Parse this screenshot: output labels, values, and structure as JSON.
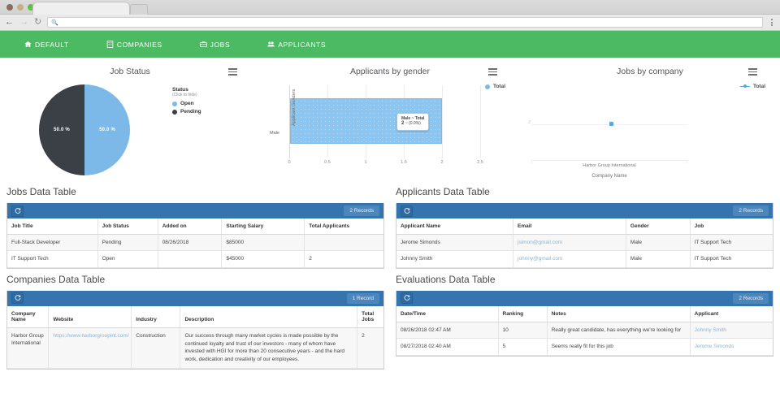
{
  "browser": {
    "url_value": "",
    "url_placeholder": "",
    "back_icon": "back-arrow-icon",
    "forward_icon": "forward-arrow-icon",
    "reload_icon": "reload-icon",
    "search_icon": "search-icon",
    "menu_icon": "kebab-menu-icon"
  },
  "appnav": {
    "items": [
      {
        "label": "DEFAULT",
        "icon": "home-icon"
      },
      {
        "label": "COMPANIES",
        "icon": "building-icon"
      },
      {
        "label": "JOBS",
        "icon": "briefcase-icon"
      },
      {
        "label": "APPLICANTS",
        "icon": "users-icon"
      }
    ],
    "bg_color": "#4cb963"
  },
  "chart_data": [
    {
      "type": "pie",
      "title": "Job Status",
      "categories": [
        "Open",
        "Pending"
      ],
      "values": [
        50.0,
        50.0
      ],
      "data_labels": [
        "50.0 %",
        "50.0 %"
      ],
      "colors": [
        "#7cb9e8",
        "#3b3f46"
      ],
      "legend": {
        "title": "Status",
        "subtitle": "(Click to hide)",
        "position": "right",
        "entries": [
          {
            "label": "Open",
            "color": "#7cb9e8"
          },
          {
            "label": "Pending",
            "color": "#3b3f46"
          }
        ]
      },
      "menu_icon": "hamburger-menu-icon"
    },
    {
      "type": "bar",
      "orientation": "horizontal",
      "title": "Applicants by gender",
      "categories": [
        "Male"
      ],
      "series": [
        {
          "name": "Total",
          "values": [
            2
          ]
        }
      ],
      "xlabel": "",
      "ylabel": "Applicant Genders",
      "xlim": [
        0,
        2.5
      ],
      "xticks": [
        "0",
        "0.5",
        "1",
        "1.5",
        "2",
        "2.5"
      ],
      "grid": true,
      "legend": {
        "position": "top-right",
        "entries": [
          {
            "label": "Total",
            "color": "#7cb9e8"
          }
        ]
      },
      "tooltip": {
        "header": "Male ~ Total",
        "value": "2",
        "percent": "~ (0.0%)"
      },
      "colors": [
        "#8cc6f0"
      ],
      "menu_icon": "hamburger-menu-icon"
    },
    {
      "type": "line",
      "title": "Jobs by company",
      "categories": [
        "Harbor Group International"
      ],
      "series": [
        {
          "name": "Total",
          "values": [
            2
          ]
        }
      ],
      "xlabel": "Company Name",
      "ylabel": "",
      "yticks": [
        "2"
      ],
      "legend": {
        "position": "top-right",
        "entries": [
          {
            "label": "Total",
            "color": "#58a7e0"
          }
        ]
      },
      "colors": [
        "#58a7e0"
      ],
      "menu_icon": "hamburger-menu-icon"
    }
  ],
  "tables": {
    "jobs": {
      "title": "Jobs Data Table",
      "records_label": "2 Records",
      "refresh_icon": "refresh-icon",
      "columns": [
        "Job Title",
        "Job Status",
        "Added on",
        "Starting Salary",
        "Total Applicants"
      ],
      "rows": [
        [
          "Full-Stack Developer",
          "Pending",
          "08/26/2018",
          "$85000",
          ""
        ],
        [
          "IT Support Tech",
          "Open",
          "",
          "$45000",
          "2"
        ]
      ]
    },
    "applicants": {
      "title": "Applicants Data Table",
      "records_label": "2 Records",
      "refresh_icon": "refresh-icon",
      "columns": [
        "Applicant Name",
        "Email",
        "Gender",
        "Job"
      ],
      "rows": [
        [
          "Jerome Simonds",
          "jsimon@gmail.com",
          "Male",
          "IT Support Tech"
        ],
        [
          "Johnny Smith",
          "johnny@gmail.com",
          "Male",
          "IT Support Tech"
        ]
      ]
    },
    "companies": {
      "title": "Companies Data Table",
      "records_label": "1 Record",
      "refresh_icon": "refresh-icon",
      "columns": [
        "Company Name",
        "Website",
        "Industry",
        "Description",
        "Total Jobs"
      ],
      "rows": [
        [
          "Harbor Group International",
          "https://www.harborgroupint.com/",
          "Construction",
          "Our success through many market cycles is made possible by the continued loyalty and trust of our investors - many of whom have invested with HGI for more than 20 consecutive years - and the hard work, dedication and creativity of our employees.",
          "2"
        ]
      ]
    },
    "evaluations": {
      "title": "Evaluations Data Table",
      "records_label": "2 Records",
      "refresh_icon": "refresh-icon",
      "columns": [
        "Date/Time",
        "Ranking",
        "Notes",
        "Applicant"
      ],
      "rows": [
        [
          "08/26/2018 02:47 AM",
          "10",
          "Really great candidate, has everything we're looking for",
          "Johnny Smith"
        ],
        [
          "08/27/2018 02:40 AM",
          "5",
          "Seems really fit for this job",
          "Jerome Simonds"
        ]
      ]
    }
  }
}
